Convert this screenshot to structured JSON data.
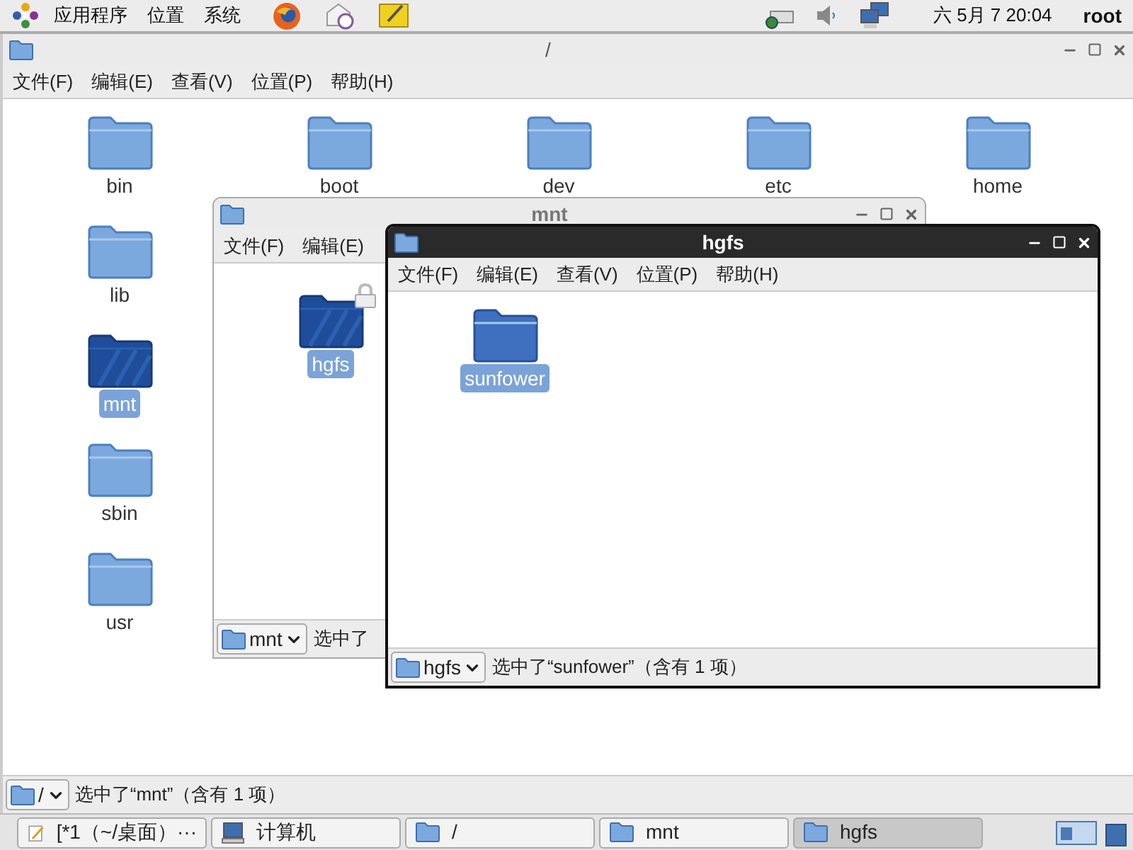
{
  "top_panel": {
    "menus": [
      {
        "label": "应用程序"
      },
      {
        "label": "位置"
      },
      {
        "label": "系统"
      }
    ],
    "clock": "六 5月 7 20:04",
    "user": "root"
  },
  "windows": [
    {
      "title": "/",
      "active": false,
      "menus": [
        "文件(F)",
        "编辑(E)",
        "查看(V)",
        "位置(P)",
        "帮助(H)"
      ],
      "items": [
        {
          "label": "bin",
          "selected": false,
          "kind": "folder"
        },
        {
          "label": "boot",
          "selected": false,
          "kind": "folder"
        },
        {
          "label": "dev",
          "selected": false,
          "kind": "folder"
        },
        {
          "label": "etc",
          "selected": false,
          "kind": "folder"
        },
        {
          "label": "home",
          "selected": false,
          "kind": "folder"
        },
        {
          "label": "lib",
          "selected": false,
          "kind": "folder"
        },
        {
          "label": "mnt",
          "selected": true,
          "kind": "folder"
        },
        {
          "label": "sbin",
          "selected": false,
          "kind": "folder"
        },
        {
          "label": "usr",
          "selected": false,
          "kind": "folder"
        }
      ],
      "location": "/",
      "status": "选中了“mnt”（含有 1 项）"
    },
    {
      "title": "mnt",
      "active": false,
      "menus": [
        "文件(F)",
        "编辑(E)"
      ],
      "items": [
        {
          "label": "hgfs",
          "selected": true,
          "kind": "locked"
        }
      ],
      "location": "mnt",
      "status": "选中了"
    },
    {
      "title": "hgfs",
      "active": true,
      "menus": [
        "文件(F)",
        "编辑(E)",
        "查看(V)",
        "位置(P)",
        "帮助(H)"
      ],
      "items": [
        {
          "label": "sunfower",
          "selected": true,
          "kind": "folder"
        }
      ],
      "location": "hgfs",
      "status": "选中了“sunfower”（含有 1 项）"
    }
  ],
  "taskbar": [
    {
      "label": "[*1（~/桌面）···",
      "kind": "editor",
      "selected": false
    },
    {
      "label": "计算机",
      "kind": "computer",
      "selected": false
    },
    {
      "label": "/",
      "kind": "folder",
      "selected": false
    },
    {
      "label": "mnt",
      "kind": "folder",
      "selected": false
    },
    {
      "label": "hgfs",
      "kind": "folder",
      "selected": true
    }
  ]
}
